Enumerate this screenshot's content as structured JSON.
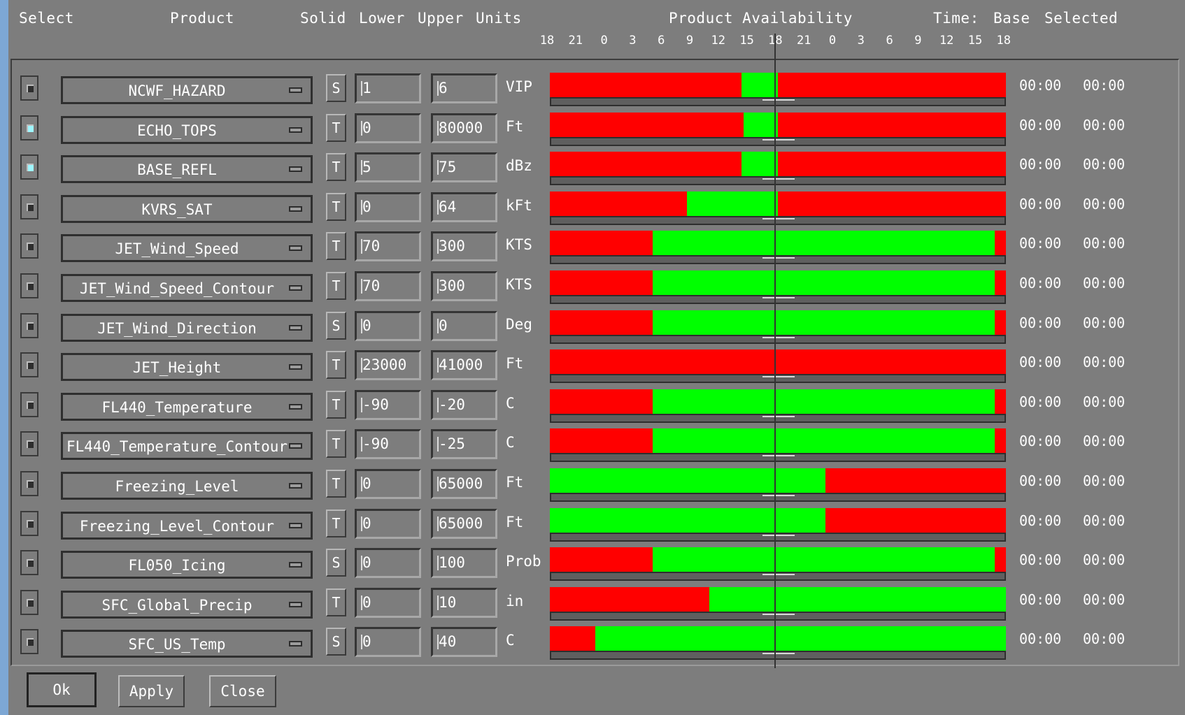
{
  "header": {
    "select": "Select",
    "product": "Product",
    "solid": "Solid",
    "lower": "Lower",
    "upper": "Upper",
    "units": "Units",
    "availability": "Product Availability",
    "time": "Time:",
    "base": "Base",
    "selected": "Selected"
  },
  "hour_ticks": [
    "18",
    "21",
    "0",
    "3",
    "6",
    "9",
    "12",
    "15",
    "18",
    "21",
    "0",
    "3",
    "6",
    "9",
    "12",
    "15",
    "18"
  ],
  "colors": {
    "available": "#00ff00",
    "unavailable": "#ff0000",
    "panel": "#7d7d7d"
  },
  "rows": [
    {
      "selected": false,
      "product": "NCWF_HAZARD",
      "solid": "S",
      "lower": "1",
      "upper": "6",
      "units": "VIP",
      "availability": [
        [
          "r",
          0.42
        ],
        [
          "g",
          0.08
        ],
        [
          "r",
          0.5
        ]
      ],
      "base_time": "00:00",
      "selected_time": "00:00"
    },
    {
      "selected": true,
      "product": "ECHO_TOPS",
      "solid": "T",
      "lower": "0",
      "upper": "80000",
      "units": "Ft",
      "availability": [
        [
          "r",
          0.425
        ],
        [
          "g",
          0.075
        ],
        [
          "r",
          0.5
        ]
      ],
      "base_time": "00:00",
      "selected_time": "00:00"
    },
    {
      "selected": true,
      "product": "BASE_REFL",
      "solid": "T",
      "lower": "5",
      "upper": "75",
      "units": "dBz",
      "availability": [
        [
          "r",
          0.42
        ],
        [
          "g",
          0.08
        ],
        [
          "r",
          0.5
        ]
      ],
      "base_time": "00:00",
      "selected_time": "00:00"
    },
    {
      "selected": false,
      "product": "KVRS_SAT",
      "solid": "T",
      "lower": "0",
      "upper": "64",
      "units": "kFt",
      "availability": [
        [
          "r",
          0.3
        ],
        [
          "g",
          0.2
        ],
        [
          "r",
          0.5
        ]
      ],
      "base_time": "00:00",
      "selected_time": "00:00"
    },
    {
      "selected": false,
      "product": "JET_Wind_Speed",
      "solid": "T",
      "lower": "70",
      "upper": "300",
      "units": "KTS",
      "availability": [
        [
          "r",
          0.225
        ],
        [
          "g",
          0.75
        ],
        [
          "r",
          0.025
        ]
      ],
      "base_time": "00:00",
      "selected_time": "00:00"
    },
    {
      "selected": false,
      "product": "JET_Wind_Speed_Contour",
      "solid": "T",
      "lower": "70",
      "upper": "300",
      "units": "KTS",
      "availability": [
        [
          "r",
          0.225
        ],
        [
          "g",
          0.75
        ],
        [
          "r",
          0.025
        ]
      ],
      "base_time": "00:00",
      "selected_time": "00:00"
    },
    {
      "selected": false,
      "product": "JET_Wind_Direction",
      "solid": "S",
      "lower": "0",
      "upper": "0",
      "units": "Deg",
      "availability": [
        [
          "r",
          0.225
        ],
        [
          "g",
          0.75
        ],
        [
          "r",
          0.025
        ]
      ],
      "base_time": "00:00",
      "selected_time": "00:00"
    },
    {
      "selected": false,
      "product": "JET_Height",
      "solid": "T",
      "lower": "23000",
      "upper": "41000",
      "units": "Ft",
      "availability": [
        [
          "r",
          1.0
        ]
      ],
      "base_time": "00:00",
      "selected_time": "00:00"
    },
    {
      "selected": false,
      "product": "FL440_Temperature",
      "solid": "T",
      "lower": "-90",
      "upper": "-20",
      "units": "C",
      "availability": [
        [
          "r",
          0.225
        ],
        [
          "g",
          0.75
        ],
        [
          "r",
          0.025
        ]
      ],
      "base_time": "00:00",
      "selected_time": "00:00"
    },
    {
      "selected": false,
      "product": "FL440_Temperature_Contour",
      "solid": "T",
      "lower": "-90",
      "upper": "-25",
      "units": "C",
      "availability": [
        [
          "r",
          0.225
        ],
        [
          "g",
          0.75
        ],
        [
          "r",
          0.025
        ]
      ],
      "base_time": "00:00",
      "selected_time": "00:00"
    },
    {
      "selected": false,
      "product": "Freezing_Level",
      "solid": "T",
      "lower": "0",
      "upper": "65000",
      "units": "Ft",
      "availability": [
        [
          "g",
          0.605
        ],
        [
          "r",
          0.395
        ]
      ],
      "base_time": "00:00",
      "selected_time": "00:00"
    },
    {
      "selected": false,
      "product": "Freezing_Level_Contour",
      "solid": "T",
      "lower": "0",
      "upper": "65000",
      "units": "Ft",
      "availability": [
        [
          "g",
          0.605
        ],
        [
          "r",
          0.395
        ]
      ],
      "base_time": "00:00",
      "selected_time": "00:00"
    },
    {
      "selected": false,
      "product": "FL050_Icing",
      "solid": "S",
      "lower": "0",
      "upper": "100",
      "units": "Prob",
      "availability": [
        [
          "r",
          0.225
        ],
        [
          "g",
          0.75
        ],
        [
          "r",
          0.025
        ]
      ],
      "base_time": "00:00",
      "selected_time": "00:00"
    },
    {
      "selected": false,
      "product": "SFC_Global_Precip",
      "solid": "T",
      "lower": "0",
      "upper": "10",
      "units": "in",
      "availability": [
        [
          "r",
          0.35
        ],
        [
          "g",
          0.65
        ]
      ],
      "base_time": "00:00",
      "selected_time": "00:00"
    },
    {
      "selected": false,
      "product": "SFC_US_Temp",
      "solid": "S",
      "lower": "0",
      "upper": "40",
      "units": "C",
      "availability": [
        [
          "r",
          0.1
        ],
        [
          "g",
          0.9
        ]
      ],
      "base_time": "00:00",
      "selected_time": "00:00"
    }
  ],
  "buttons": {
    "ok": "Ok",
    "apply": "Apply",
    "close": "Close"
  }
}
